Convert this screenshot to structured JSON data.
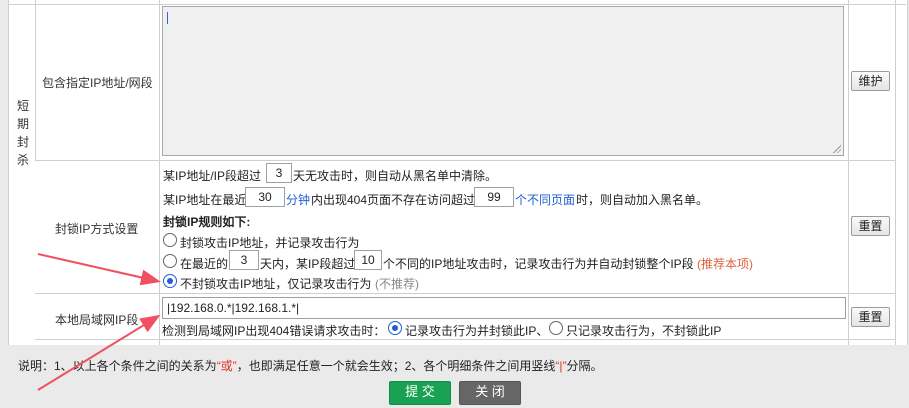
{
  "section_vertical_label": "短期封杀",
  "rows": {
    "include_ip": {
      "label": "包含指定IP地址/网段",
      "textarea_value": "",
      "button": "维护"
    },
    "block_method": {
      "label": "封锁IP方式设置",
      "line1_pre": "某IP地址/IP段超过",
      "line1_days": "3",
      "line1_post": "天无攻击时，则自动从黑名单中清除。",
      "line2_pre": "某IP地址在最近",
      "line2_minutes": "30",
      "line2_unit": "分钟",
      "line2_mid": "内出现404页面不存在访问超过",
      "line2_count": "99",
      "line2_unit2": "个不同页面",
      "line2_post": "时，则自动加入黑名单。",
      "rules_title": "封锁IP规则如下:",
      "opt1": "封锁攻击IP地址，并记录攻击行为",
      "opt2_pre": "在最近的",
      "opt2_days": "3",
      "opt2_mid": "天内，某IP段超过",
      "opt2_count": "10",
      "opt2_post": "个不同的IP地址攻击时，记录攻击行为并自动封锁整个IP段",
      "opt2_tag": "(推荐本项)",
      "opt3": "不封锁攻击IP地址，仅记录攻击行为",
      "opt3_tag": "(不推荐)",
      "selected_option": 3,
      "button": "重置"
    },
    "lan_ip": {
      "label": "本地局域网IP段",
      "input_value": "|192.168.0.*|192.168.1.*|",
      "detect_text": "检测到局域网IP出现404错误请求攻击时：",
      "choice1": "记录攻击行为并封锁此IP、",
      "choice2": "只记录攻击行为，不封锁此IP",
      "selected_choice": 1,
      "button": "重置"
    }
  },
  "note": {
    "pre": "说明：1、以上各个条件之间的关系为",
    "or_word": "“或”",
    "mid": "，也即满足任意一个就会生效；2、各个明细条件之间用竖线",
    "bar": "“|”",
    "post": "分隔。"
  },
  "buttons": {
    "submit": "提 交",
    "close": "关 闭"
  },
  "colors": {
    "accent_blue": "#1f5fd6",
    "recommend_orange": "#e0603a",
    "submit_green": "#1aa254",
    "arrow_red": "#f05060"
  }
}
